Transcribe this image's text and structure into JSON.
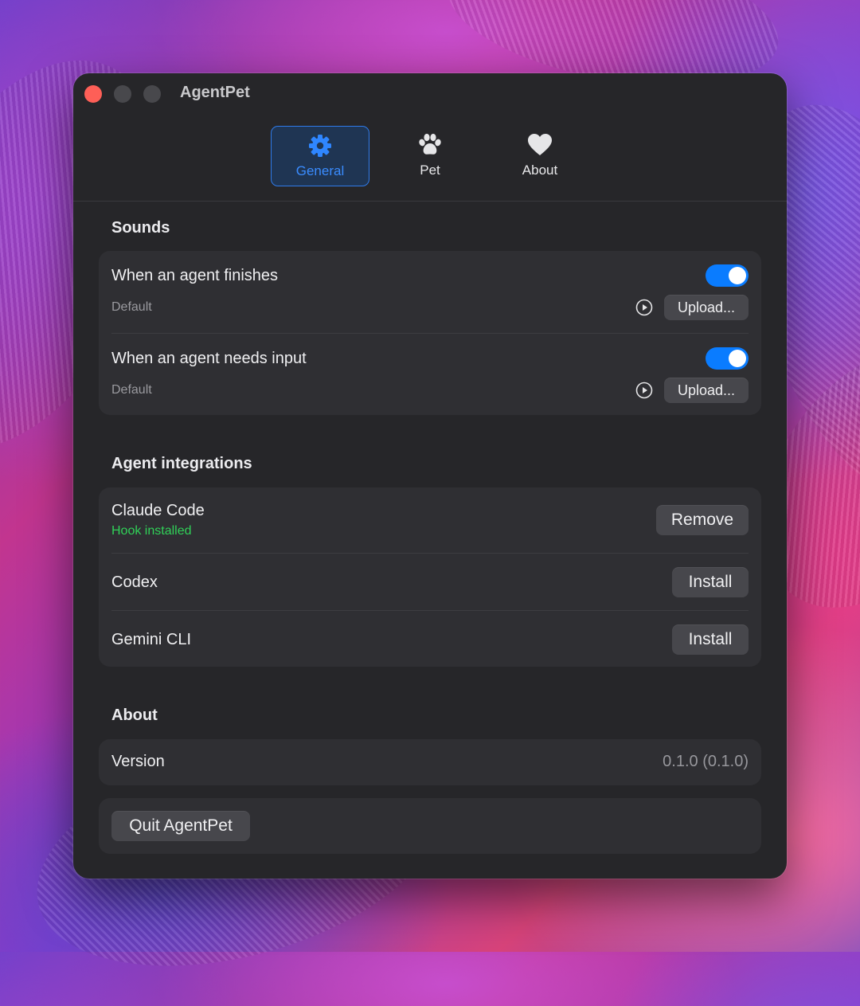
{
  "window": {
    "title": "AgentPet"
  },
  "tabs": [
    {
      "label": "General",
      "icon": "gear-icon",
      "active": true
    },
    {
      "label": "Pet",
      "icon": "paw-icon",
      "active": false
    },
    {
      "label": "About",
      "icon": "heart-icon",
      "active": false
    }
  ],
  "sounds": {
    "title": "Sounds",
    "rows": [
      {
        "label": "When an agent finishes",
        "sub": "Default",
        "enabled": true,
        "upload_label": "Upload..."
      },
      {
        "label": "When an agent needs input",
        "sub": "Default",
        "enabled": true,
        "upload_label": "Upload..."
      }
    ]
  },
  "integrations": {
    "title": "Agent integrations",
    "rows": [
      {
        "label": "Claude Code",
        "status": "Hook installed",
        "action": "Remove"
      },
      {
        "label": "Codex",
        "action": "Install"
      },
      {
        "label": "Gemini CLI",
        "action": "Install"
      }
    ]
  },
  "about": {
    "title": "About",
    "version_label": "Version",
    "version_value": "0.1.0 (0.1.0)",
    "quit_label": "Quit AgentPet"
  },
  "colors": {
    "accent": "#0a7cff",
    "status_green": "#30d158",
    "window_bg": "#262629",
    "card_bg": "#2f2f33",
    "close_red": "#fe5f57"
  }
}
